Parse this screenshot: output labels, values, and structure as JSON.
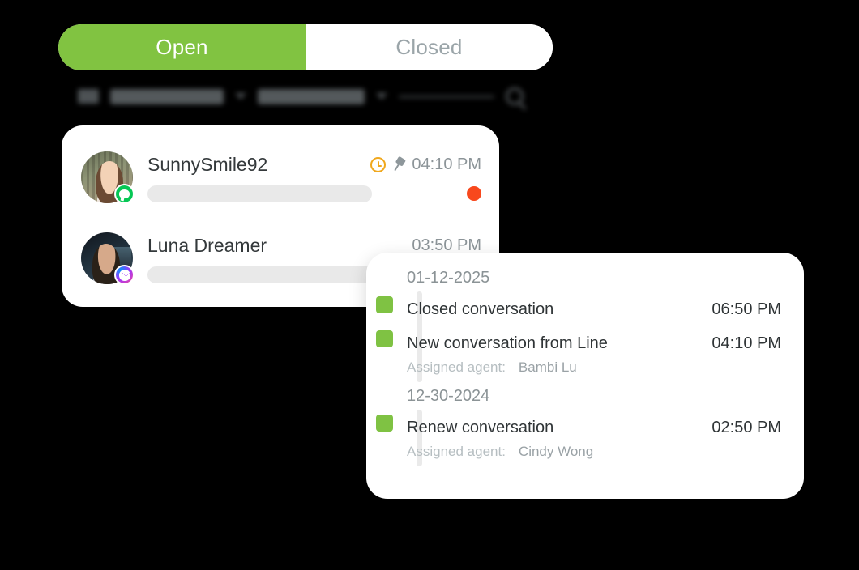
{
  "tabs": {
    "open_label": "Open",
    "closed_label": "Closed",
    "active": "Open"
  },
  "filter_toolbar": {
    "visible": true,
    "blurred": true,
    "filter_icon": "filter-icon",
    "channel_filter_label": "ALL CHANNELS",
    "secondary_filter_label": "ALL USERS",
    "search_icon": "search-icon"
  },
  "conversations": {
    "items": [
      {
        "name": "SunnySmile92",
        "time": "04:10 PM",
        "channel": "line",
        "channel_badge": "line-badge-icon",
        "pinned": true,
        "pin_icon": "pin-icon",
        "snooze_icon": "clock-icon",
        "unread": true,
        "unread_color": "#f8481d",
        "preview_placeholder": ""
      },
      {
        "name": "Luna Dreamer",
        "time": "03:50 PM",
        "channel": "messenger",
        "channel_badge": "messenger-badge-icon",
        "pinned": false,
        "unread": false,
        "preview_placeholder": ""
      }
    ]
  },
  "activity_log": {
    "groups": [
      {
        "date": "01-12-2025",
        "entries": [
          {
            "title": "Closed conversation",
            "time": "06:50 PM",
            "marker_color": "#7fc243",
            "agent_label": null,
            "agent_name": null
          },
          {
            "title": "New conversation from Line",
            "time": "04:10 PM",
            "marker_color": "#7fc243",
            "agent_label": "Assigned agent:",
            "agent_name": "Bambi Lu"
          }
        ]
      },
      {
        "date": "12-30-2024",
        "entries": [
          {
            "title": "Renew conversation",
            "time": "02:50 PM",
            "marker_color": "#7fc243",
            "agent_label": "Assigned agent:",
            "agent_name": "Cindy Wong"
          }
        ]
      }
    ]
  },
  "colors": {
    "brand_green": "#81c341",
    "marker_green": "#7fc243",
    "unread_red": "#f8481d",
    "muted_gray": "#8c9498",
    "text_dark": "#34393b",
    "clock_amber": "#f0a81e",
    "background": "#000000"
  }
}
